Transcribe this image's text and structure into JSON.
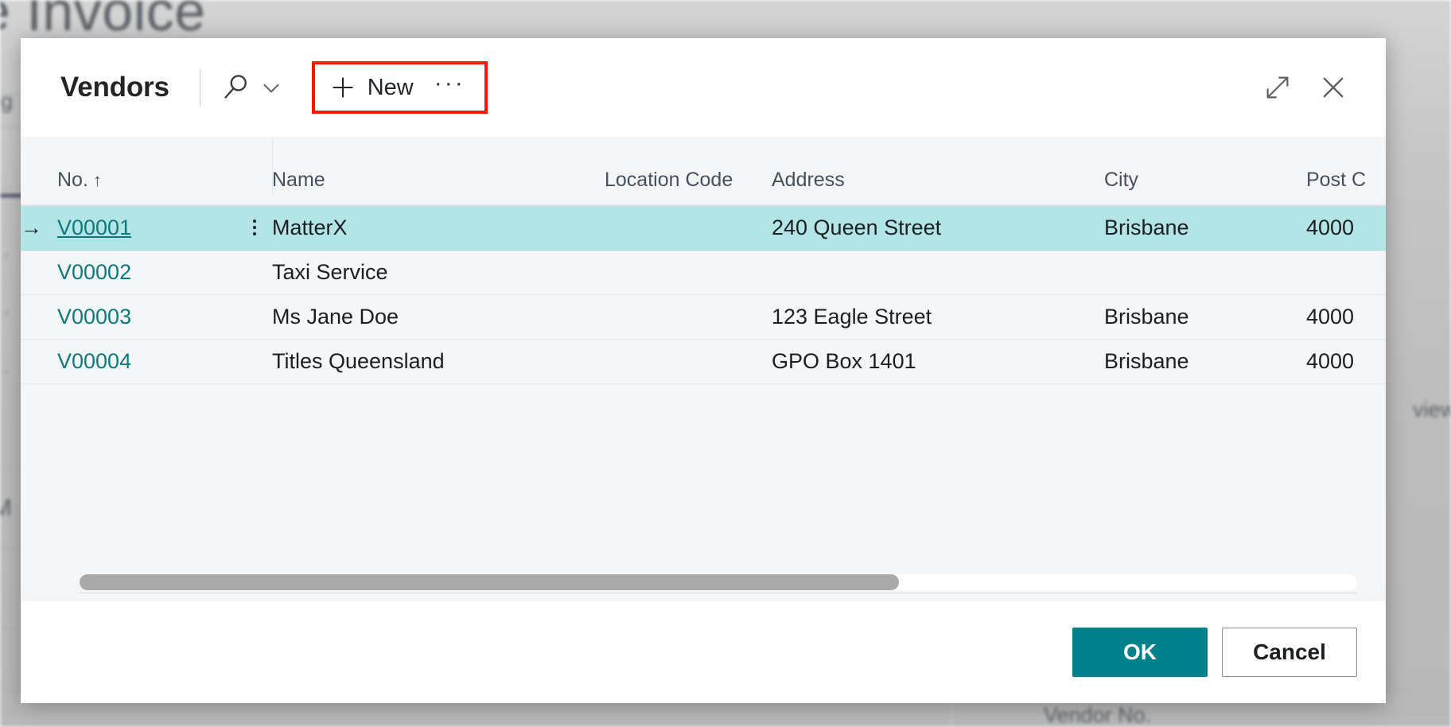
{
  "background": {
    "page_title": "e Invoice",
    "fragment_left": "ng",
    "fragment_m": "M",
    "fragment_right": "view",
    "field_label": "Vendor No."
  },
  "dialog": {
    "title": "Vendors",
    "search_icon": "search-icon",
    "chevron_icon": "chevron-down-icon",
    "new_label": "New",
    "plus_icon": "plus-icon",
    "more_label": "···",
    "expand_icon": "expand-icon",
    "close_icon": "close-icon",
    "highlight_color": "#ff1500"
  },
  "table": {
    "columns": [
      {
        "key": "no",
        "label": "No.",
        "sort": "↑"
      },
      {
        "key": "name",
        "label": "Name"
      },
      {
        "key": "location_code",
        "label": "Location Code"
      },
      {
        "key": "address",
        "label": "Address"
      },
      {
        "key": "city",
        "label": "City"
      },
      {
        "key": "post_code",
        "label": "Post C"
      }
    ],
    "rows": [
      {
        "selected": true,
        "row_arrow": "→",
        "no": "V00001",
        "name": "MatterX",
        "location_code": "",
        "address": "240 Queen Street",
        "city": "Brisbane",
        "post_code": "4000"
      },
      {
        "selected": false,
        "row_arrow": "",
        "no": "V00002",
        "name": "Taxi Service",
        "location_code": "",
        "address": "",
        "city": "",
        "post_code": ""
      },
      {
        "selected": false,
        "row_arrow": "",
        "no": "V00003",
        "name": "Ms Jane Doe",
        "location_code": "",
        "address": "123 Eagle Street",
        "city": "Brisbane",
        "post_code": "4000"
      },
      {
        "selected": false,
        "row_arrow": "",
        "no": "V00004",
        "name": "Titles Queensland",
        "location_code": "",
        "address": "GPO Box 1401",
        "city": "Brisbane",
        "post_code": "4000"
      }
    ]
  },
  "footer": {
    "ok_label": "OK",
    "cancel_label": "Cancel",
    "ok_color": "#00808a"
  }
}
